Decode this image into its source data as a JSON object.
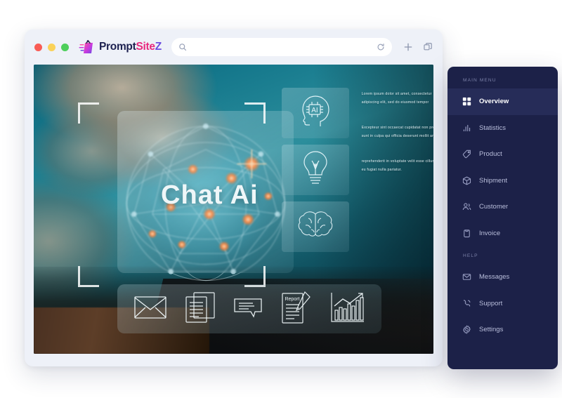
{
  "browser": {
    "traffic_lights": [
      {
        "name": "close",
        "color": "#f95c55"
      },
      {
        "name": "minimize",
        "color": "#fad259"
      },
      {
        "name": "maximize",
        "color": "#4ecf5c"
      }
    ],
    "brand": {
      "part1": "Prompt",
      "part2": "Site",
      "part3": "Z",
      "logo_icon": "shopping-bag-icon"
    },
    "address_bar": {
      "value": "",
      "placeholder": "",
      "search_icon": "search-icon",
      "reload_icon": "reload-icon"
    },
    "actions": [
      {
        "name": "new-tab-button",
        "icon": "plus-icon"
      },
      {
        "name": "tabs-button",
        "icon": "copy-tabs-icon"
      }
    ]
  },
  "hero": {
    "headline": "Chat Ai",
    "cards": [
      {
        "icon": "ai-head-icon",
        "label": "AI"
      },
      {
        "icon": "lightbulb-icon",
        "label": ""
      },
      {
        "icon": "brain-icon",
        "label": ""
      }
    ],
    "paragraphs": [
      "Lorem ipsum dolor sit amet, consectetur adipiscing elit, sed do eiusmod tempor",
      "Excepteur sint occaecat cupidatat non proident, sunt in culpa qui officia deserunt mollit anim",
      "reprehenderit in voluptate velit esse cillum dolore eu fugiat nulla pariatur."
    ],
    "toolbar_icons": [
      {
        "name": "envelope-icon"
      },
      {
        "name": "documents-icon"
      },
      {
        "name": "chat-bubble-icon"
      },
      {
        "name": "report-edit-icon"
      },
      {
        "name": "bar-chart-growth-icon"
      }
    ],
    "report_label": "Report"
  },
  "sidebar": {
    "sections": [
      {
        "title": "MAIN MENU",
        "items": [
          {
            "label": "Overview",
            "icon": "grid-icon",
            "active": true
          },
          {
            "label": "Statistics",
            "icon": "bar-chart-icon",
            "active": false
          },
          {
            "label": "Product",
            "icon": "tag-icon",
            "active": false
          },
          {
            "label": "Shipment",
            "icon": "box-icon",
            "active": false
          },
          {
            "label": "Customer",
            "icon": "users-icon",
            "active": false
          },
          {
            "label": "Invoice",
            "icon": "clipboard-icon",
            "active": false
          }
        ]
      },
      {
        "title": "HELP",
        "items": [
          {
            "label": "Messages",
            "icon": "mail-icon",
            "active": false
          },
          {
            "label": "Support",
            "icon": "phone-icon",
            "active": false
          },
          {
            "label": "Settings",
            "icon": "gear-icon",
            "active": false
          }
        ]
      }
    ]
  },
  "colors": {
    "sidebar_bg": "#1c2148",
    "sidebar_active": "#262c58",
    "browser_chrome": "#eef1f8",
    "brand_pink": "#e8297e",
    "brand_purple": "#6b4ce0",
    "brand_navy": "#1d2150"
  }
}
